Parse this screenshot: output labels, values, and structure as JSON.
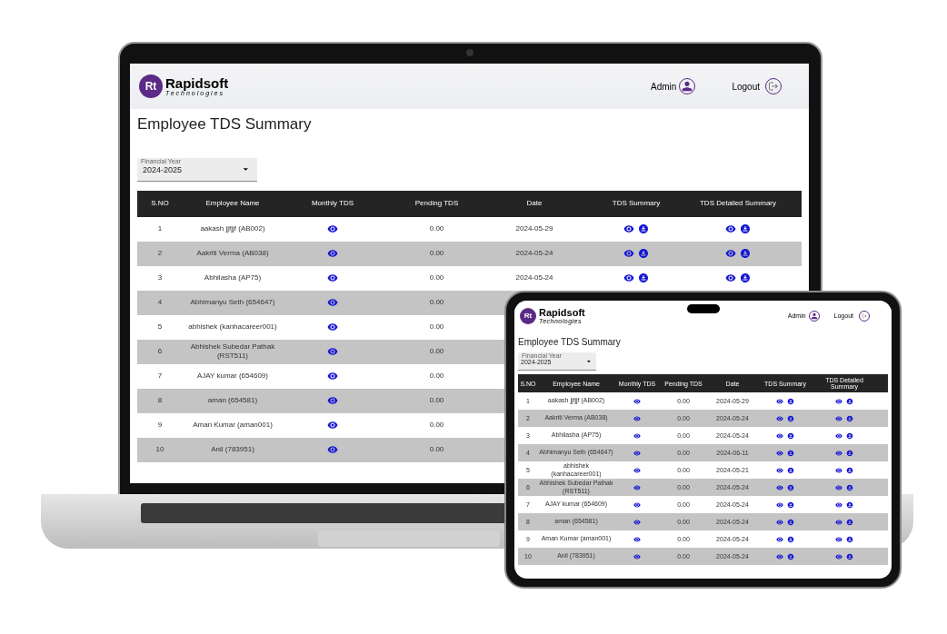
{
  "laptop": {
    "logo": {
      "mark": "Rt",
      "name": "Rapidsoft",
      "tagline": "Technologies"
    },
    "header": {
      "user": "Admin",
      "logout": "Logout"
    },
    "title": "Employee TDS Summary",
    "filter": {
      "label": "Financial Year",
      "value": "2024-2025"
    },
    "table": {
      "columns": [
        "S.NO",
        "Employee Name",
        "Monthly TDS",
        "Pending TDS",
        "Date",
        "TDS Summary",
        "TDS Detailed Summary"
      ],
      "rows": [
        {
          "sno": "1",
          "name": "aakash jjfjjf (AB002)",
          "pending": "0.00",
          "date": "2024-05-29"
        },
        {
          "sno": "2",
          "name": "Aakriti Verma (AB038)",
          "pending": "0.00",
          "date": "2024-05-24"
        },
        {
          "sno": "3",
          "name": "Abhilasha (AP75)",
          "pending": "0.00",
          "date": "2024-05-24"
        },
        {
          "sno": "4",
          "name": "Abhimanyu Seth (654647)",
          "pending": "0.00"
        },
        {
          "sno": "5",
          "name": "abhishek (kanhacareer001)",
          "pending": "0.00"
        },
        {
          "sno": "6",
          "name": "Abhishek Subedar Pathak (RST511)",
          "pending": "0.00"
        },
        {
          "sno": "7",
          "name": "AJAY kumar (654609)",
          "pending": "0.00"
        },
        {
          "sno": "8",
          "name": "aman (654581)",
          "pending": "0.00"
        },
        {
          "sno": "9",
          "name": "Aman Kumar (aman001)",
          "pending": "0.00"
        },
        {
          "sno": "10",
          "name": "Anil (783951)",
          "pending": "0.00"
        }
      ]
    }
  },
  "tablet": {
    "logo": {
      "mark": "Rt",
      "name": "Rapidsoft",
      "tagline": "Technologies"
    },
    "header": {
      "user": "Admin",
      "logout": "Logout"
    },
    "title": "Employee TDS Summary",
    "filter": {
      "label": "Financial Year",
      "value": "2024-2025"
    },
    "table": {
      "columns": [
        "S.NO",
        "Employee Name",
        "Monthly TDS",
        "Pending TDS",
        "Date",
        "TDS Summary",
        "TDS Detailed Summary"
      ],
      "rows": [
        {
          "sno": "1",
          "name": "aakash jjfjjf (AB002)",
          "pending": "0.00",
          "date": "2024-05-29"
        },
        {
          "sno": "2",
          "name": "Aakriti Verma (AB038)",
          "pending": "0.00",
          "date": "2024-05-24"
        },
        {
          "sno": "3",
          "name": "Abhilasha (AP75)",
          "pending": "0.00",
          "date": "2024-05-24"
        },
        {
          "sno": "4",
          "name": "Abhimanyu Seth (654647)",
          "pending": "0.00",
          "date": "2024-06-11"
        },
        {
          "sno": "5",
          "name": "abhishek (kanhacareer001)",
          "pending": "0.00",
          "date": "2024-05-21"
        },
        {
          "sno": "6",
          "name": "Abhishek Subedar Pathak (RST511)",
          "pending": "0.00",
          "date": "2024-05-24"
        },
        {
          "sno": "7",
          "name": "AJAY kumar (654609)",
          "pending": "0.00",
          "date": "2024-05-24"
        },
        {
          "sno": "8",
          "name": "aman (654581)",
          "pending": "0.00",
          "date": "2024-05-24"
        },
        {
          "sno": "9",
          "name": "Aman Kumar (aman001)",
          "pending": "0.00",
          "date": "2024-05-24"
        },
        {
          "sno": "10",
          "name": "Anil (783951)",
          "pending": "0.00",
          "date": "2024-05-24"
        }
      ]
    }
  }
}
